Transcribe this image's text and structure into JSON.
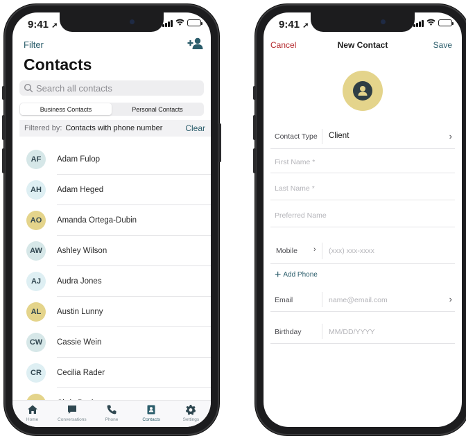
{
  "left_phone": {
    "status": {
      "time": "9:41"
    },
    "header": {
      "filter_label": "Filter",
      "title": "Contacts",
      "add_icon": "add-person-icon"
    },
    "search": {
      "placeholder": "Search all contacts"
    },
    "segments": [
      {
        "label": "Business Contacts",
        "selected": true
      },
      {
        "label": "Personal Contacts",
        "selected": false
      }
    ],
    "filter_bar": {
      "label": "Filtered by:",
      "value": "Contacts with phone number",
      "clear": "Clear"
    },
    "contacts": [
      {
        "initials": "AF",
        "name": "Adam Fulop",
        "color": "#d6e7e8"
      },
      {
        "initials": "AH",
        "name": "Adam Heged",
        "color": "#deeff3"
      },
      {
        "initials": "AO",
        "name": "Amanda Ortega-Dubin",
        "color": "#e4d48b"
      },
      {
        "initials": "AW",
        "name": "Ashley Wilson",
        "color": "#d6e7e8"
      },
      {
        "initials": "AJ",
        "name": "Audra Jones",
        "color": "#deeff3"
      },
      {
        "initials": "AL",
        "name": "Austin Lunny",
        "color": "#e4d48b"
      },
      {
        "initials": "CW",
        "name": "Cassie Wein",
        "color": "#d6e7e8"
      },
      {
        "initials": "CR",
        "name": "Cecilia Rader",
        "color": "#deeff3"
      },
      {
        "initials": "CB",
        "name": "Chris Beck",
        "color": "#e4d48b"
      }
    ],
    "tabs": [
      {
        "label": "Home",
        "icon": "home-icon",
        "active": false
      },
      {
        "label": "Conversations",
        "icon": "chat-icon",
        "active": false
      },
      {
        "label": "Phone",
        "icon": "phone-icon",
        "active": false
      },
      {
        "label": "Contacts",
        "icon": "contacts-icon",
        "active": true
      },
      {
        "label": "Settings",
        "icon": "gear-icon",
        "active": false
      }
    ]
  },
  "right_phone": {
    "status": {
      "time": "9:41"
    },
    "nav": {
      "cancel": "Cancel",
      "title": "New Contact",
      "save": "Save"
    },
    "form": {
      "contact_type_label": "Contact Type",
      "contact_type_value": "Client",
      "first_name_placeholder": "First Name *",
      "last_name_placeholder": "Last Name *",
      "preferred_name_placeholder": "Preferred Name",
      "phone_type": "Mobile",
      "phone_placeholder": "(xxx) xxx-xxxx",
      "add_phone": "Add Phone",
      "email_label": "Email",
      "email_placeholder": "name@email.com",
      "birthday_label": "Birthday",
      "birthday_placeholder": "MM/DD/YYYY"
    }
  }
}
